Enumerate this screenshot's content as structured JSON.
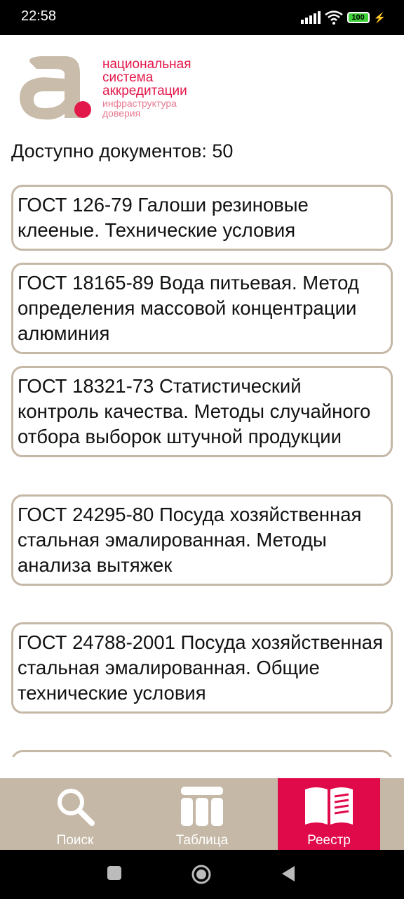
{
  "status": {
    "time": "22:58",
    "battery": "100"
  },
  "logo": {
    "line1": "национальная",
    "line2": "система",
    "line3": "аккредитации",
    "tagline1": "инфраструктура",
    "tagline2": "доверия"
  },
  "doc_count": "Доступно документов: 50",
  "documents": [
    "ГОСТ 126-79 Галоши резиновые клееные. Технические условия",
    "ГОСТ 18165-89 Вода питьевая. Метод определения массовой концентрации алюминия",
    "ГОСТ 18321-73 Статистический контроль качества. Методы случайного отбора выборок штучной продукции",
    "ГОСТ 24295-80 Посуда хозяйственная стальная эмалированная. Методы анализа вытяжек",
    "ГОСТ 24788-2001 Посуда хозяйственная стальная эмалированная. Общие технические условия"
  ],
  "nav": [
    {
      "label": "Поиск",
      "icon": "search-icon",
      "active": false
    },
    {
      "label": "Таблица",
      "icon": "table-icon",
      "active": false
    },
    {
      "label": "Реестр",
      "icon": "book-icon",
      "active": true
    }
  ],
  "colors": {
    "accent": "#e0094a",
    "beige": "#c5b8a6"
  }
}
